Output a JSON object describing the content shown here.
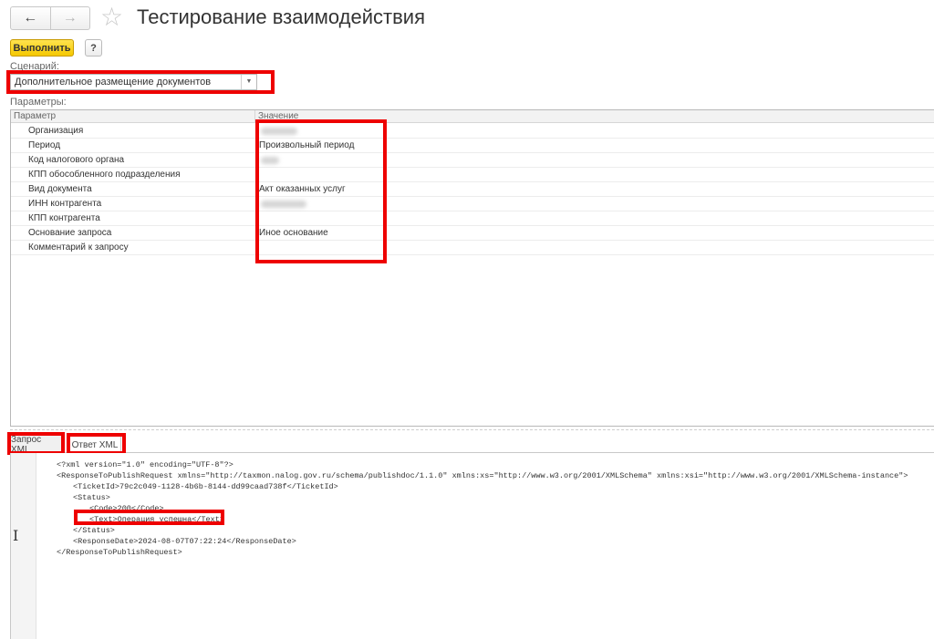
{
  "header": {
    "back_icon": "←",
    "forward_icon": "→",
    "star_icon": "☆",
    "title": "Тестирование взаимодействия"
  },
  "toolbar": {
    "run_label": "Выполнить",
    "help_label": "?"
  },
  "scenario": {
    "label": "Сценарий:",
    "value": "Дополнительное размещение документов",
    "arrow_icon": "▼"
  },
  "parameters": {
    "label": "Параметры:",
    "columns": [
      "Параметр",
      "Значение"
    ],
    "rows": [
      {
        "name": "Организация",
        "value": ""
      },
      {
        "name": "Период",
        "value": "Произвольный период"
      },
      {
        "name": "Код налогового органа",
        "value": ""
      },
      {
        "name": "КПП обособленного подразделения",
        "value": ""
      },
      {
        "name": "Вид документа",
        "value": "Акт оказанных услуг"
      },
      {
        "name": "ИНН контрагента",
        "value": ""
      },
      {
        "name": "КПП контрагента",
        "value": ""
      },
      {
        "name": "Основание запроса",
        "value": "Иное основание"
      },
      {
        "name": "Комментарий к запросу",
        "value": ""
      }
    ]
  },
  "tabs": [
    {
      "label": "Запрос XML"
    },
    {
      "label": "Ответ XML"
    }
  ],
  "xml_lines": [
    "<?xml version=\"1.0\" encoding=\"UTF-8\"?>",
    "<ResponseToPublishRequest xmlns=\"http://taxmon.nalog.gov.ru/schema/publishdoc/1.1.0\" xmlns:xs=\"http://www.w3.org/2001/XMLSchema\" xmlns:xsi=\"http://www.w3.org/2001/XMLSchema-instance\">",
    "<TicketId>79c2c049-1128-4b6b-8144-dd99caad738f</TicketId>",
    "<Status>",
    "<Code>200</Code>",
    "<Text>Операция успешна</Text>",
    "</Status>",
    "<ResponseDate>2024-08-07T07:22:24</ResponseDate>",
    "</ResponseToPublishRequest>"
  ],
  "colors": {
    "highlight": "#ee0000",
    "run_button": "#f5c800"
  }
}
